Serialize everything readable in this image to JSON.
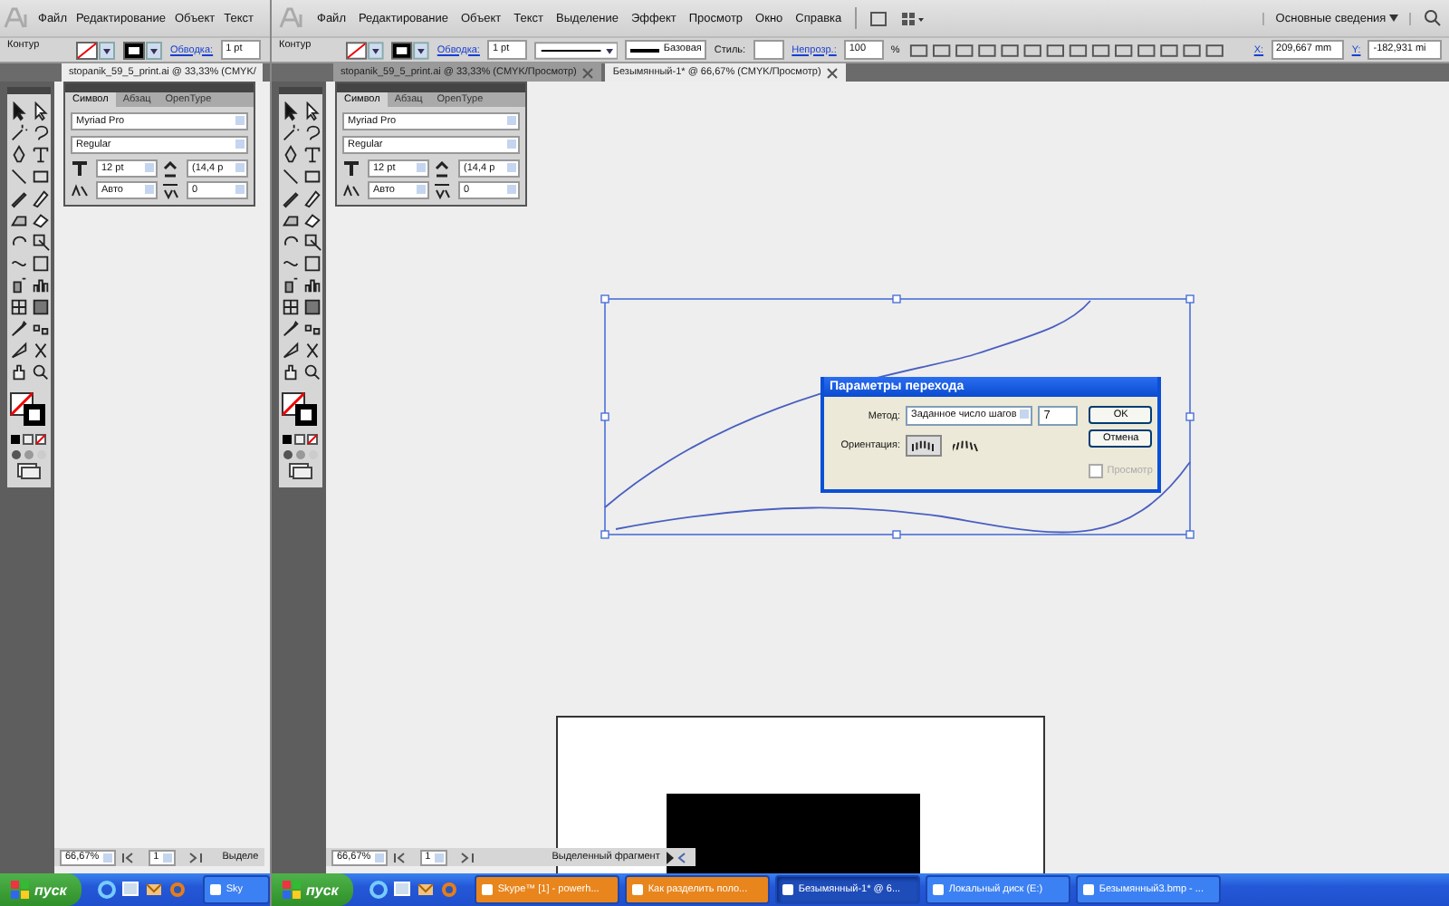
{
  "windows": [
    {
      "menu": [
        "Файл",
        "Редактирование",
        "Объект",
        "Текст"
      ],
      "control": {
        "label": "Контур",
        "stroke_label": "Обводка:",
        "stroke_weight": "1 pt"
      },
      "doc_tabs": [
        {
          "label": "stopanik_59_5_print.ai @ 33,33% (CMYK/",
          "selected": true
        }
      ],
      "char_panel": {
        "tabs": [
          {
            "label": "Символ",
            "selected": true
          },
          {
            "label": "Абзац",
            "selected": false
          },
          {
            "label": "OpenType",
            "selected": false
          }
        ],
        "font": "Myriad Pro",
        "style": "Regular",
        "size": "12 pt",
        "leading": "(14,4 p",
        "kerning": "Авто",
        "tracking": "0"
      },
      "status": {
        "zoom": "66,67%",
        "page": "1",
        "info": "Выделе"
      },
      "taskbar": {
        "start": "пуск",
        "tasks": [
          {
            "label": "Sky",
            "selected": false
          }
        ]
      }
    },
    {
      "menu": [
        "Файл",
        "Редактирование",
        "Объект",
        "Текст",
        "Выделение",
        "Эффект",
        "Просмотр",
        "Окно",
        "Справка"
      ],
      "workspace": "Основные сведения",
      "control": {
        "label": "Контур",
        "stroke_label": "Обводка:",
        "stroke_weight": "1 pt",
        "profile": "Базовая",
        "style_label": "Стиль:",
        "opacity_label": "Непрозр.:",
        "opacity": "100",
        "percent": "%",
        "x_label": "X:",
        "x": "209,667 mm",
        "y_label": "Y:",
        "y": "-182,931 mi"
      },
      "doc_tabs": [
        {
          "label": "stopanik_59_5_print.ai @ 33,33% (CMYK/Просмотр)",
          "selected": false
        },
        {
          "label": "Безымянный-1* @ 66,67% (CMYK/Просмотр)",
          "selected": true
        }
      ],
      "char_panel": {
        "tabs": [
          {
            "label": "Символ",
            "selected": true
          },
          {
            "label": "Абзац",
            "selected": false
          },
          {
            "label": "OpenType",
            "selected": false
          }
        ],
        "font": "Myriad Pro",
        "style": "Regular",
        "size": "12 pt",
        "leading": "(14,4 p",
        "kerning": "Авто",
        "tracking": "0"
      },
      "dialog": {
        "title": "Параметры перехода",
        "method_label": "Метод:",
        "method": "Заданное число шагов",
        "steps": "7",
        "ok": "OK",
        "cancel": "Отмена",
        "orientation_label": "Ориентация:",
        "orientations": [
          {
            "selected": true
          },
          {
            "selected": false
          }
        ],
        "preview": {
          "label": "Просмотр",
          "checked": false,
          "disabled": true
        }
      },
      "status": {
        "zoom": "66,67%",
        "page": "1",
        "info": "Выделенный фрагмент"
      },
      "taskbar": {
        "start": "пуск",
        "tasks": [
          {
            "label": "Skype™ [1] - powerh...",
            "selected": false
          },
          {
            "label": "Как разделить поло...",
            "selected": false
          },
          {
            "label": "Безымянный-1* @ 6...",
            "selected": true
          },
          {
            "label": "Локальный диск (E:)",
            "selected": false
          },
          {
            "label": "Безымянный3.bmp - ...",
            "selected": false
          }
        ]
      }
    }
  ]
}
